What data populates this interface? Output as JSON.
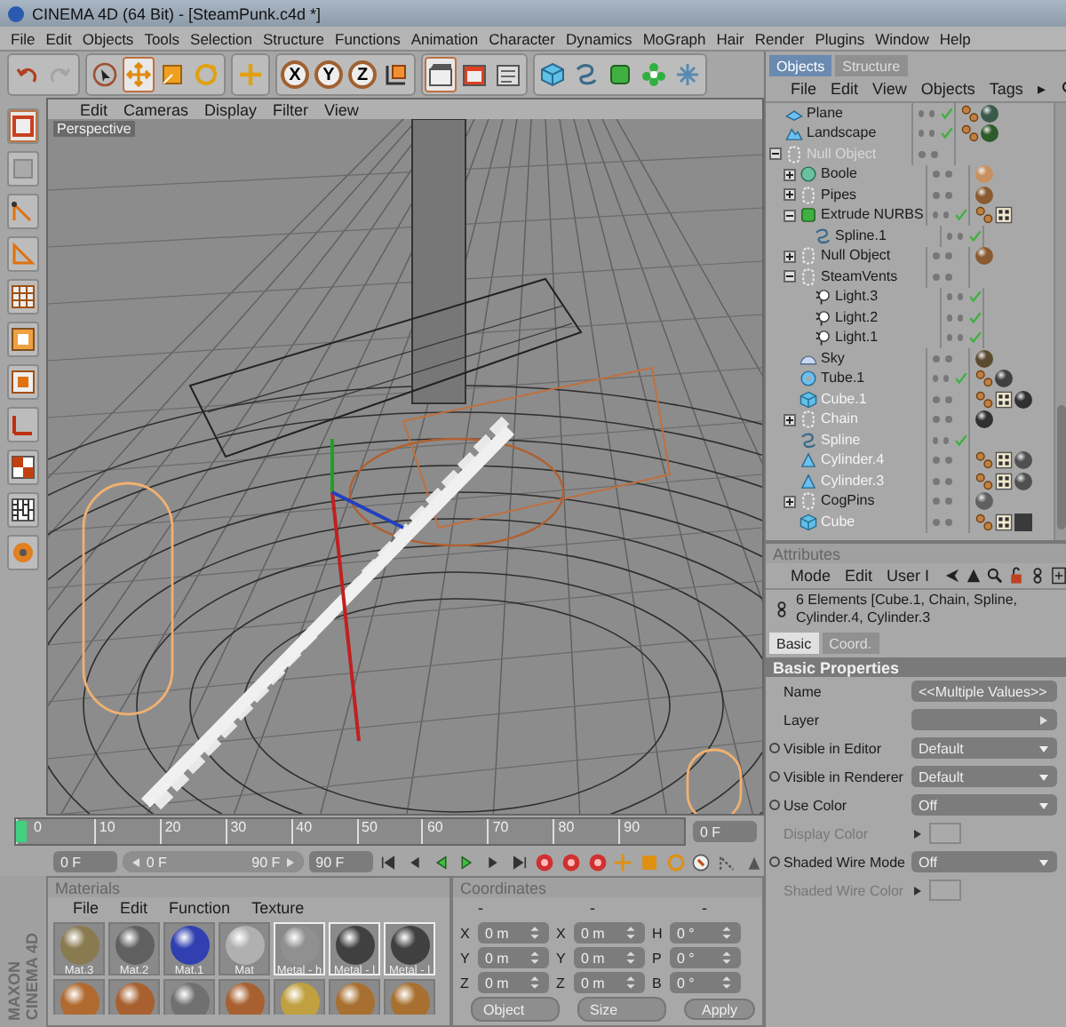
{
  "window": {
    "title": "CINEMA 4D (64 Bit) - [SteamPunk.c4d *]"
  },
  "menu": [
    "File",
    "Edit",
    "Objects",
    "Tools",
    "Selection",
    "Structure",
    "Functions",
    "Animation",
    "Character",
    "Dynamics",
    "MoGraph",
    "Hair",
    "Render",
    "Plugins",
    "Window",
    "Help"
  ],
  "toolbar": [
    [
      {
        "kind": "undo",
        "active": false
      },
      {
        "kind": "redo",
        "active": false
      }
    ],
    [
      {
        "kind": "select",
        "active": false
      },
      {
        "kind": "move",
        "active": true
      },
      {
        "kind": "scale",
        "active": false
      },
      {
        "kind": "rotate",
        "active": false
      }
    ],
    [
      {
        "kind": "live-move",
        "active": false
      }
    ],
    [
      {
        "kind": "axis",
        "label": "X",
        "active": false
      },
      {
        "kind": "axis",
        "label": "Y",
        "active": false
      },
      {
        "kind": "axis",
        "label": "Z",
        "active": false
      },
      {
        "kind": "coord",
        "active": false
      }
    ],
    [
      {
        "kind": "render-view",
        "active": true
      },
      {
        "kind": "render-picture",
        "active": false
      },
      {
        "kind": "render-settings",
        "active": false
      }
    ],
    [
      {
        "kind": "cube",
        "active": false
      },
      {
        "kind": "spline",
        "active": false
      },
      {
        "kind": "nurbs",
        "active": false
      },
      {
        "kind": "cloner",
        "active": false
      },
      {
        "kind": "deformer",
        "active": false
      }
    ]
  ],
  "left_toolbar": [
    {
      "kind": "model",
      "active": true
    },
    {
      "kind": "object",
      "active": false
    },
    {
      "kind": "points",
      "active": false
    },
    {
      "kind": "edges",
      "active": false
    },
    {
      "kind": "polygons",
      "active": false
    },
    {
      "kind": "uv",
      "active": false
    },
    {
      "kind": "texture",
      "active": false
    },
    {
      "kind": "axis",
      "active": false
    },
    {
      "kind": "grid",
      "active": false
    },
    {
      "kind": "checker",
      "active": false
    },
    {
      "kind": "snap",
      "active": false
    }
  ],
  "viewport": {
    "menu": [
      "Edit",
      "Cameras",
      "Display",
      "Filter",
      "View"
    ],
    "camera": "Perspective"
  },
  "objects": {
    "tabs": [
      {
        "label": "Objects",
        "selected": true
      },
      {
        "label": "Structure",
        "selected": false
      }
    ],
    "menu": [
      "File",
      "Edit",
      "View",
      "Objects",
      "Tags"
    ],
    "more": "▸",
    "items": [
      {
        "name": "Plane",
        "kind": "plane",
        "selected": false,
        "disabled": false,
        "check": true,
        "tags": [
          {
            "kind": "phong"
          },
          {
            "kind": "material",
            "color": "#3a5a4a"
          }
        ]
      },
      {
        "name": "Landscape",
        "kind": "landscape",
        "selected": false,
        "disabled": false,
        "check": true,
        "tags": [
          {
            "kind": "phong"
          },
          {
            "kind": "material",
            "color": "#2f5a2a"
          }
        ]
      },
      {
        "name": "Null Object",
        "kind": "null",
        "expanded": true,
        "selected": false,
        "disabled": true,
        "check": false,
        "children": [
          {
            "name": "Boole",
            "kind": "boole",
            "expanded": false,
            "selected": false,
            "disabled": false,
            "check": false,
            "tags": [
              {
                "kind": "sphere",
                "color": "#c89060"
              }
            ]
          },
          {
            "name": "Pipes",
            "kind": "null",
            "expanded": false,
            "selected": false,
            "disabled": false,
            "check": false,
            "tags": [
              {
                "kind": "sphere",
                "color": "#8a5a30"
              }
            ]
          },
          {
            "name": "Extrude NURBS",
            "kind": "nurbs",
            "expanded": true,
            "selected": false,
            "disabled": false,
            "check": true,
            "tags": [
              {
                "kind": "phong"
              },
              {
                "kind": "texture"
              }
            ],
            "children": [
              {
                "name": "Spline.1",
                "kind": "spline",
                "selected": false,
                "disabled": false,
                "check": true
              }
            ]
          },
          {
            "name": "Null Object",
            "kind": "null",
            "expanded": false,
            "selected": false,
            "disabled": false,
            "check": false,
            "tags": [
              {
                "kind": "sphere",
                "color": "#8a5a30"
              }
            ]
          },
          {
            "name": "SteamVents",
            "kind": "null",
            "expanded": true,
            "selected": false,
            "disabled": false,
            "check": false,
            "children": [
              {
                "name": "Light.3",
                "kind": "light",
                "selected": false,
                "disabled": false,
                "check": true
              },
              {
                "name": "Light.2",
                "kind": "light",
                "selected": false,
                "disabled": false,
                "check": true
              },
              {
                "name": "Light.1",
                "kind": "light",
                "selected": false,
                "disabled": false,
                "check": true
              }
            ]
          },
          {
            "name": "Sky",
            "kind": "sky",
            "selected": false,
            "disabled": false,
            "check": false,
            "tags": [
              {
                "kind": "sphere",
                "color": "#5a4a30"
              }
            ]
          },
          {
            "name": "Tube.1",
            "kind": "tube",
            "selected": false,
            "disabled": false,
            "check": true,
            "tags": [
              {
                "kind": "phong"
              },
              {
                "kind": "sphere",
                "color": "#404040"
              }
            ]
          },
          {
            "name": "Cube.1",
            "kind": "cube",
            "selected": true,
            "disabled": false,
            "check": false,
            "tags": [
              {
                "kind": "phong"
              },
              {
                "kind": "texture"
              },
              {
                "kind": "sphere",
                "color": "#303030"
              }
            ]
          },
          {
            "name": "Chain",
            "kind": "null",
            "expanded": false,
            "selected": true,
            "disabled": false,
            "check": false,
            "tags": [
              {
                "kind": "sphere",
                "color": "#303030"
              }
            ]
          },
          {
            "name": "Spline",
            "kind": "spline",
            "selected": true,
            "disabled": false,
            "check": true
          },
          {
            "name": "Cylinder.4",
            "kind": "cylinder",
            "selected": true,
            "disabled": false,
            "check": false,
            "tags": [
              {
                "kind": "phong"
              },
              {
                "kind": "texture"
              },
              {
                "kind": "sphere",
                "color": "#505050"
              }
            ]
          },
          {
            "name": "Cylinder.3",
            "kind": "cylinder",
            "selected": true,
            "disabled": false,
            "check": false,
            "tags": [
              {
                "kind": "phong"
              },
              {
                "kind": "texture"
              },
              {
                "kind": "sphere",
                "color": "#505050"
              }
            ]
          },
          {
            "name": "CogPins",
            "kind": "null",
            "expanded": false,
            "selected": false,
            "disabled": false,
            "check": false,
            "tags": [
              {
                "kind": "sphere",
                "color": "#606060"
              }
            ]
          },
          {
            "name": "Cube",
            "kind": "cube",
            "selected": true,
            "disabled": false,
            "check": false,
            "tags": [
              {
                "kind": "phong"
              },
              {
                "kind": "texture"
              },
              {
                "kind": "square",
                "color": "#3a3a3a"
              }
            ]
          }
        ]
      }
    ]
  },
  "attributes": {
    "title": "Attributes",
    "menu": [
      "Mode",
      "Edit",
      "User I"
    ],
    "header": "6 Elements [Cube.1, Chain, Spline, Cylinder.4, Cylinder.3",
    "tabs": [
      {
        "label": "Basic",
        "selected": true
      },
      {
        "label": "Coord.",
        "selected": false
      }
    ],
    "section": "Basic Properties",
    "props": [
      {
        "label": "Name",
        "kind": "text",
        "value": "<<Multiple Values>>",
        "animatable": false,
        "disabled": false
      },
      {
        "label": "Layer",
        "kind": "layer",
        "animatable": false,
        "disabled": false
      },
      {
        "label": "Visible in Editor",
        "kind": "dropdown",
        "value": "Default",
        "animatable": true,
        "disabled": false
      },
      {
        "label": "Visible in Renderer",
        "kind": "dropdown",
        "value": "Default",
        "animatable": true,
        "disabled": false
      },
      {
        "label": "Use Color",
        "kind": "dropdown",
        "value": "Off",
        "animatable": true,
        "disabled": false
      },
      {
        "label": "Display Color",
        "kind": "color",
        "animatable": false,
        "disabled": true
      },
      {
        "label": "Shaded Wire Mode",
        "kind": "dropdown",
        "value": "Off",
        "animatable": true,
        "disabled": false
      },
      {
        "label": "Shaded Wire Color",
        "kind": "color",
        "animatable": false,
        "disabled": true
      }
    ]
  },
  "timeline": {
    "ticks": [
      "0",
      "10",
      "20",
      "30",
      "40",
      "50",
      "60",
      "70",
      "80",
      "90"
    ],
    "level": 0,
    "current": "0 F"
  },
  "range": {
    "level": 1,
    "start": "0 F",
    "slider_start": "0 F",
    "slider_end": "90 F",
    "end": "90 F"
  },
  "playback": [
    {
      "kind": "first"
    },
    {
      "kind": "prev-key"
    },
    {
      "kind": "prev-frame"
    },
    {
      "kind": "play"
    },
    {
      "kind": "next-key"
    },
    {
      "kind": "last"
    },
    {
      "kind": "record"
    },
    {
      "kind": "record"
    },
    {
      "kind": "record"
    },
    {
      "kind": "key-move"
    },
    {
      "kind": "key-scale"
    },
    {
      "kind": "key-rotate"
    },
    {
      "kind": "key-param"
    },
    {
      "kind": "key-points"
    },
    {
      "kind": "key-auto"
    }
  ],
  "materials": {
    "title": "Materials",
    "menu": [
      "File",
      "Edit",
      "Function",
      "Texture"
    ],
    "items": [
      {
        "name": "Mat.3",
        "color": "#8a7a50",
        "selected": false
      },
      {
        "name": "Mat.2",
        "color": "#606060",
        "selected": false
      },
      {
        "name": "Mat.1",
        "color": "#3040b0",
        "selected": false
      },
      {
        "name": "Mat",
        "color": "#b0b0b0",
        "selected": false
      },
      {
        "name": "Metal - h",
        "color": "#909090",
        "selected": true
      },
      {
        "name": "Metal - l",
        "color": "#404040",
        "selected": true
      },
      {
        "name": "Metal - l",
        "color": "#404040",
        "selected": true
      },
      {
        "color": "#b06a30",
        "selected": false
      },
      {
        "color": "#a86030",
        "selected": false
      },
      {
        "color": "#707070",
        "selected": false
      },
      {
        "color": "#a86030",
        "selected": false
      },
      {
        "color": "#c0a040",
        "selected": false
      },
      {
        "color": "#a87030",
        "selected": false
      },
      {
        "color": "#a87030",
        "selected": false
      }
    ]
  },
  "logo": {
    "brand": "MAXON",
    "product": "CINEMA 4D"
  },
  "coordinates": {
    "title": "Coordinates",
    "headers": [
      "-",
      "-",
      "-"
    ],
    "rows": [
      [
        {
          "axis": "X",
          "value": "0 m"
        },
        {
          "axis": "X",
          "value": "0 m"
        },
        {
          "axis": "H",
          "value": "0 °"
        }
      ],
      [
        {
          "axis": "Y",
          "value": "0 m"
        },
        {
          "axis": "Y",
          "value": "0 m"
        },
        {
          "axis": "P",
          "value": "0 °"
        }
      ],
      [
        {
          "axis": "Z",
          "value": "0 m"
        },
        {
          "axis": "Z",
          "value": "0 m"
        },
        {
          "axis": "B",
          "value": "0 °"
        }
      ]
    ],
    "mode": "Object",
    "size": "Size",
    "apply": "Apply"
  }
}
